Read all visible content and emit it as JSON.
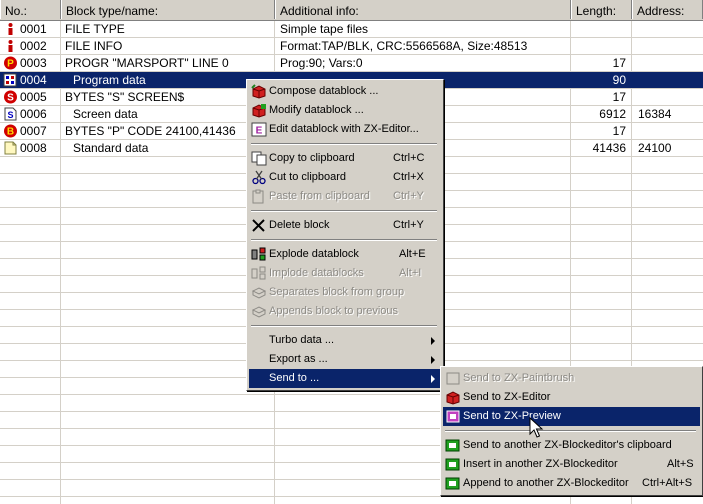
{
  "columns": [
    "No.:",
    "Block type/name:",
    "Additional info:",
    "Length:",
    "Address:"
  ],
  "rows": [
    {
      "no": "0001",
      "type": "FILE TYPE",
      "info": "Simple tape files",
      "length": "",
      "address": "",
      "icon": "info-icon",
      "indent": false
    },
    {
      "no": "0002",
      "type": "FILE INFO",
      "info": "Format:TAP/BLK,  CRC:5566568A,  Size:48513",
      "length": "",
      "address": "",
      "icon": "info-icon",
      "indent": false
    },
    {
      "no": "0003",
      "type": "PROGR \"MARSPORT\" LINE 0",
      "info": "Prog:90;  Vars:0",
      "length": "17",
      "address": "",
      "icon": "program-header-icon",
      "indent": false
    },
    {
      "no": "0004",
      "type": "Program data",
      "info": "",
      "length": "90",
      "address": "",
      "icon": "program-data-icon",
      "indent": true
    },
    {
      "no": "0005",
      "type": "BYTES \"S\" SCREEN$",
      "info": "",
      "length": "17",
      "address": "",
      "icon": "screen-header-icon",
      "indent": false
    },
    {
      "no": "0006",
      "type": "Screen data",
      "info": "",
      "length": "6912",
      "address": "16384",
      "icon": "screen-data-icon",
      "indent": true
    },
    {
      "no": "0007",
      "type": "BYTES \"P\" CODE 24100,41436",
      "info": "",
      "length": "17",
      "address": "",
      "icon": "bytes-header-icon",
      "indent": false
    },
    {
      "no": "0008",
      "type": "Standard data",
      "info": "",
      "length": "41436",
      "address": "24100",
      "icon": "standard-data-icon",
      "indent": true
    }
  ],
  "selected_row": "0004",
  "context_menu": {
    "items": [
      {
        "label": "Compose datablock ...",
        "shortcut": "",
        "disabled": false,
        "icon": "compose-icon"
      },
      {
        "label": "Modify datablock ...",
        "shortcut": "",
        "disabled": false,
        "icon": "modify-icon"
      },
      {
        "label": "Edit datablock with ZX-Editor...",
        "shortcut": "",
        "disabled": false,
        "icon": "zx-editor-icon"
      },
      {
        "label": "Copy to clipboard",
        "shortcut": "Ctrl+C",
        "disabled": false,
        "icon": "copy-icon"
      },
      {
        "label": "Cut to clipboard",
        "shortcut": "Ctrl+X",
        "disabled": false,
        "icon": "scissors-icon"
      },
      {
        "label": "Paste from clipboard",
        "shortcut": "Ctrl+Y",
        "disabled": true,
        "icon": "paste-icon"
      },
      {
        "label": "Delete block",
        "shortcut": "Ctrl+Y",
        "disabled": false,
        "icon": "delete-icon"
      },
      {
        "label": "Explode datablock",
        "shortcut": "Alt+E",
        "disabled": false,
        "icon": "explode-icon"
      },
      {
        "label": "Implode datablocks",
        "shortcut": "Alt+I",
        "disabled": true,
        "icon": "implode-icon"
      },
      {
        "label": "Separates block from group",
        "shortcut": "",
        "disabled": true,
        "icon": "separate-icon"
      },
      {
        "label": "Appends block to previous",
        "shortcut": "",
        "disabled": true,
        "icon": "append-icon"
      },
      {
        "label": "Turbo data ...",
        "shortcut": "",
        "disabled": false,
        "icon": ""
      },
      {
        "label": "Export as ...",
        "shortcut": "",
        "disabled": false,
        "icon": ""
      },
      {
        "label": "Send to ...",
        "shortcut": "",
        "disabled": false,
        "icon": ""
      }
    ]
  },
  "submenu": {
    "items": [
      {
        "label": "Send to ZX-Paintbrush",
        "shortcut": "",
        "disabled": true,
        "icon": "paintbrush-icon"
      },
      {
        "label": "Send to ZX-Editor",
        "shortcut": "",
        "disabled": false,
        "icon": "zx-editor-icon"
      },
      {
        "label": "Send to ZX-Preview",
        "shortcut": "",
        "disabled": false,
        "icon": "preview-icon"
      },
      {
        "label": "Send to another ZX-Blockeditor's clipboard",
        "shortcut": "",
        "disabled": false,
        "icon": "blockeditor-icon"
      },
      {
        "label": "Insert in another ZX-Blockeditor",
        "shortcut": "Alt+S",
        "disabled": false,
        "icon": "blockeditor-icon"
      },
      {
        "label": "Append to another ZX-Blockeditor",
        "shortcut": "Ctrl+Alt+S",
        "disabled": false,
        "icon": "blockeditor-icon"
      }
    ]
  },
  "colors": {
    "selection": "#0a246a",
    "face": "#d4d0c8",
    "grid": "#d4d0c8"
  }
}
